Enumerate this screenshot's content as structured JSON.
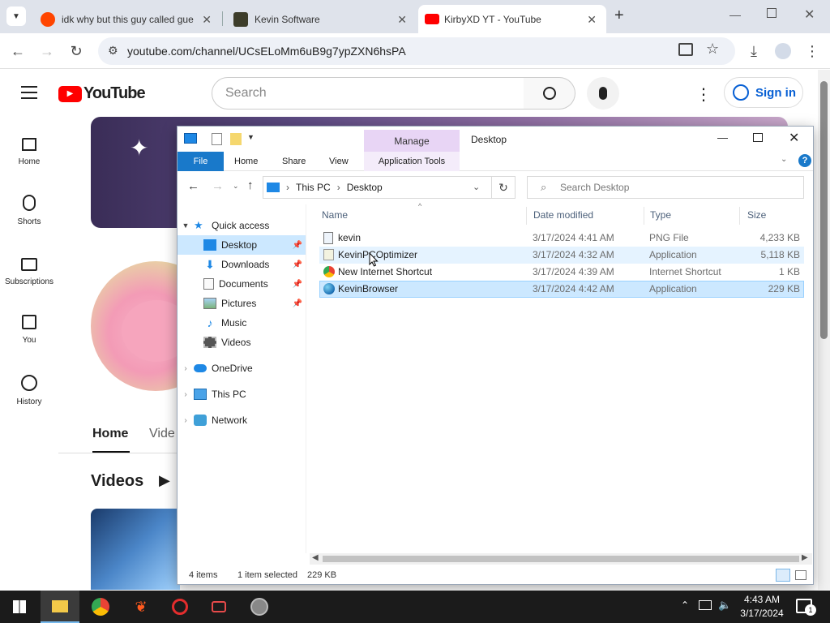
{
  "browser": {
    "tabs": [
      {
        "title": "idk why but this guy called gue",
        "active": false
      },
      {
        "title": "Kevin Software",
        "active": false
      },
      {
        "title": "KirbyXD YT - YouTube",
        "active": true
      }
    ],
    "url": "youtube.com/channel/UCsELoMm6uB9g7ypZXN6hsPA"
  },
  "youtube": {
    "logo_text": "YouTube",
    "search_placeholder": "Search",
    "sign_in": "Sign in",
    "nav": [
      {
        "label": "Home",
        "icon": "home-icon"
      },
      {
        "label": "Shorts",
        "icon": "shorts-icon"
      },
      {
        "label": "Subscriptions",
        "icon": "subscriptions-icon"
      },
      {
        "label": "You",
        "icon": "you-icon"
      },
      {
        "label": "History",
        "icon": "history-icon"
      }
    ],
    "channel_tabs": [
      "Home",
      "Vide"
    ],
    "section_title": "Videos"
  },
  "explorer": {
    "title": "Desktop",
    "quick_access_toolbar": "",
    "contextual_group": "Manage",
    "ribbon_tabs": [
      "File",
      "Home",
      "Share",
      "View",
      "Application Tools"
    ],
    "breadcrumb": [
      "This PC",
      "Desktop"
    ],
    "search_placeholder": "Search Desktop",
    "nav": {
      "quick_access": "Quick access",
      "items": [
        {
          "label": "Desktop",
          "pinned": true,
          "selected": true
        },
        {
          "label": "Downloads",
          "pinned": true
        },
        {
          "label": "Documents",
          "pinned": true
        },
        {
          "label": "Pictures",
          "pinned": true
        },
        {
          "label": "Music",
          "pinned": false
        },
        {
          "label": "Videos",
          "pinned": false
        }
      ],
      "roots": [
        "OneDrive",
        "This PC",
        "Network"
      ]
    },
    "columns": [
      "Name",
      "Date modified",
      "Type",
      "Size"
    ],
    "files": [
      {
        "name": "kevin",
        "date": "3/17/2024 4:41 AM",
        "type": "PNG File",
        "size": "4,233 KB",
        "icon": "image-file-icon"
      },
      {
        "name": "KevinPCOptimizer",
        "date": "3/17/2024 4:32 AM",
        "type": "Application",
        "size": "5,118 KB",
        "icon": "app-file-icon"
      },
      {
        "name": "New Internet Shortcut",
        "date": "3/17/2024 4:39 AM",
        "type": "Internet Shortcut",
        "size": "1 KB",
        "icon": "chrome-shortcut-icon"
      },
      {
        "name": "KevinBrowser",
        "date": "3/17/2024 4:42 AM",
        "type": "Application",
        "size": "229 KB",
        "icon": "globe-app-icon"
      }
    ],
    "status": {
      "count": "4 items",
      "selected": "1 item selected",
      "size": "229 KB"
    }
  },
  "taskbar": {
    "time": "4:43 AM",
    "date": "3/17/2024",
    "notification_count": "1"
  },
  "colors": {
    "yt_red": "#ff0000",
    "selection": "#cce8ff",
    "manage_tab": "#e8d5f5",
    "file_tab": "#1979ca"
  }
}
